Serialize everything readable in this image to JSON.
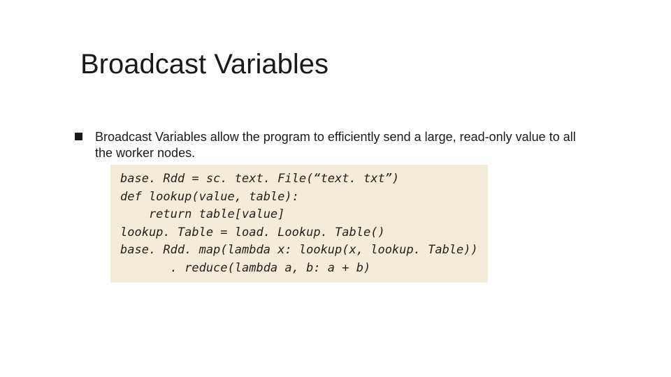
{
  "title": "Broadcast Variables",
  "bullet": "Broadcast Variables allow the program to efficiently send a large, read-only value to all the worker nodes.",
  "code": {
    "l1": "base. Rdd = sc. text. File(“text. txt”)",
    "l2": "def lookup(value, table):",
    "l3": "    return table[value]",
    "l4": "lookup. Table = load. Lookup. Table()",
    "l5": "base. Rdd. map(lambda x: lookup(x, lookup. Table))",
    "l6": "       . reduce(lambda a, b: a + b)"
  }
}
